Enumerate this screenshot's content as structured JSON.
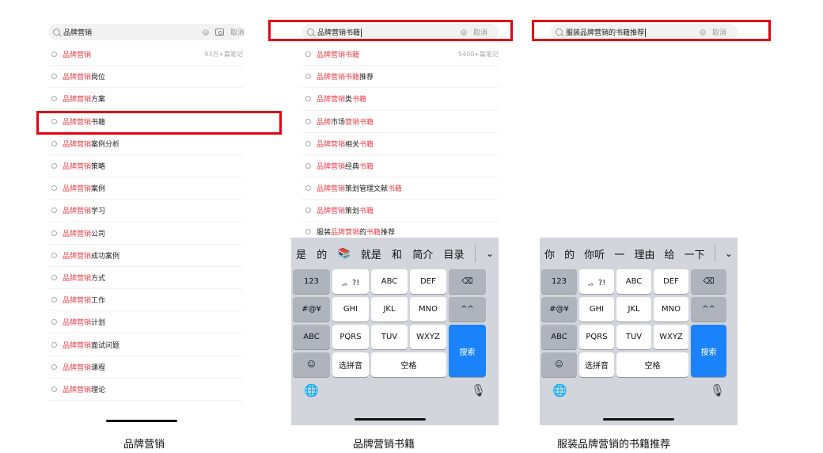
{
  "panels": {
    "p1": {
      "query": "品牌营销",
      "cancel": "取消",
      "caption": "品牌营销",
      "rows": [
        {
          "hl": "品牌营销",
          "rest": "",
          "count": "93万+篇笔记"
        },
        {
          "hl": "品牌营销",
          "rest": "岗位"
        },
        {
          "hl": "品牌营销",
          "rest": "方案"
        },
        {
          "hl": "品牌营销",
          "rest": "书籍"
        },
        {
          "hl": "品牌营销",
          "rest": "案例分析"
        },
        {
          "hl": "品牌营销",
          "rest": "策略"
        },
        {
          "hl": "品牌营销",
          "rest": "案例"
        },
        {
          "hl": "品牌营销",
          "rest": "学习"
        },
        {
          "hl": "品牌营销",
          "rest": "公司"
        },
        {
          "hl": "品牌营销",
          "rest": "成功案例"
        },
        {
          "hl": "品牌营销",
          "rest": "方式"
        },
        {
          "hl": "品牌营销",
          "rest": "工作"
        },
        {
          "hl": "品牌营销",
          "rest": "计划"
        },
        {
          "hl": "品牌营销",
          "rest": "面试问题"
        },
        {
          "hl": "品牌营销",
          "rest": "课程"
        },
        {
          "hl": "品牌营销",
          "rest": "理论"
        }
      ]
    },
    "p2": {
      "query": "品牌营销书籍",
      "cancel": "取消",
      "caption": "品牌营销书籍",
      "rows": [
        {
          "a": "品牌营销书籍",
          "b": "",
          "c": "",
          "count": "5400+篇笔记"
        },
        {
          "a": "品牌营销书籍",
          "b": "推荐",
          "c": ""
        },
        {
          "a": "品牌营销",
          "b": "类",
          "c": "书籍"
        },
        {
          "a": "品牌",
          "b": "市场",
          "c": "营销书籍"
        },
        {
          "a": "品牌营销",
          "b": "相关",
          "c": "书籍"
        },
        {
          "a": "品牌营销",
          "b": "经典",
          "c": "书籍"
        },
        {
          "a": "品牌营销",
          "b": "策划管理文献",
          "c": "书籍"
        },
        {
          "a": "品牌营销",
          "b": "策划",
          "c": "书籍"
        }
      ],
      "last_row": {
        "pre": "服装",
        "a": "品牌营销",
        "b": "的",
        "c": "书籍",
        "d": "推荐"
      },
      "candidates": [
        "是",
        "的",
        "📚",
        "就是",
        "和",
        "简介",
        "目录"
      ]
    },
    "p3": {
      "query": "服装品牌营销的书籍推荐",
      "cancel": "取消",
      "caption": "服装品牌营销的书籍推荐",
      "candidates": [
        "你",
        "的",
        "你听",
        "一",
        "理由",
        "给",
        "一下"
      ]
    }
  },
  "keyboard": {
    "k123": "123",
    "punct": ",。?!",
    "abc": "ABC",
    "def": "DEF",
    "delete": "⌫",
    "sym": "#@¥",
    "ghi": "GHI",
    "jkl": "JKL",
    "mno": "MNO",
    "face": "^^",
    "abc_switch": "ABC",
    "pqrs": "PQRS",
    "tuv": "TUV",
    "wxyz": "WXYZ",
    "search": "搜索",
    "emoji": "☺",
    "pinyin": "选拼音",
    "space": "空格",
    "globe": "🌐",
    "mic": "🎙",
    "chevron": "⌄"
  }
}
